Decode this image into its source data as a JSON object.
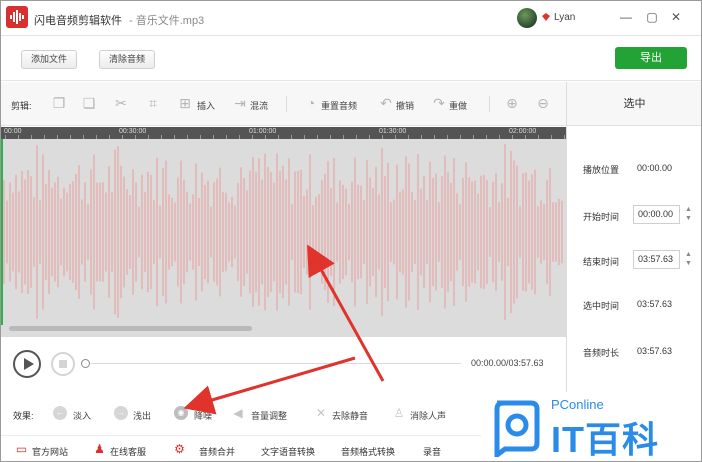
{
  "app": {
    "title": "闪电音频剪辑软件",
    "file_title": "- 音乐文件.mp3",
    "user_name": "Lyan"
  },
  "window": {
    "minimize": "—",
    "restore": "▢",
    "close": "✕"
  },
  "topbar": {
    "add_file": "添加文件",
    "clear_audio": "清除音频",
    "export": "导出"
  },
  "edit_toolbar": {
    "label": "剪辑:",
    "insert": "插入",
    "mix": "混流",
    "reset_audio": "重置音频",
    "undo": "撤销",
    "redo": "重做"
  },
  "ruler": {
    "ticks": [
      "00:00",
      "00:30:00",
      "01:00:00",
      "01:30:00",
      "02:00:00"
    ]
  },
  "side_panel": {
    "title": "选中",
    "play_position_label": "播放位置",
    "play_position_value": "00:00.00",
    "start_time_label": "开始时间",
    "start_time_value": "00:00.00",
    "end_time_label": "结束时间",
    "end_time_value": "03:57.63",
    "selected_time_label": "选中时间",
    "selected_time_value": "03:57.63",
    "duration_label": "音频时长",
    "duration_value": "03:57.63"
  },
  "player": {
    "time_readout": "00:00.00/03:57.63"
  },
  "effects": {
    "label": "效果:",
    "fade_in": "淡入",
    "fade_out": "浅出",
    "denoise": "降噪",
    "volume_adjust": "音量调整",
    "remove_silence": "去除静音",
    "remove_vocals": "消除人声"
  },
  "bottom_links": {
    "official_site": "官方网站",
    "online_service": "在线客服",
    "audio_merge": "音频合并",
    "text_to_speech": "文字语音转换",
    "format_convert": "音频格式转换",
    "record": "录音"
  },
  "watermark": {
    "brand_small": "PConline",
    "brand_big": "IT百科"
  },
  "colors": {
    "accent_red": "#d8302f",
    "export_green": "#23a335",
    "wave": "#e79a9a",
    "arrow": "#e0332c"
  }
}
